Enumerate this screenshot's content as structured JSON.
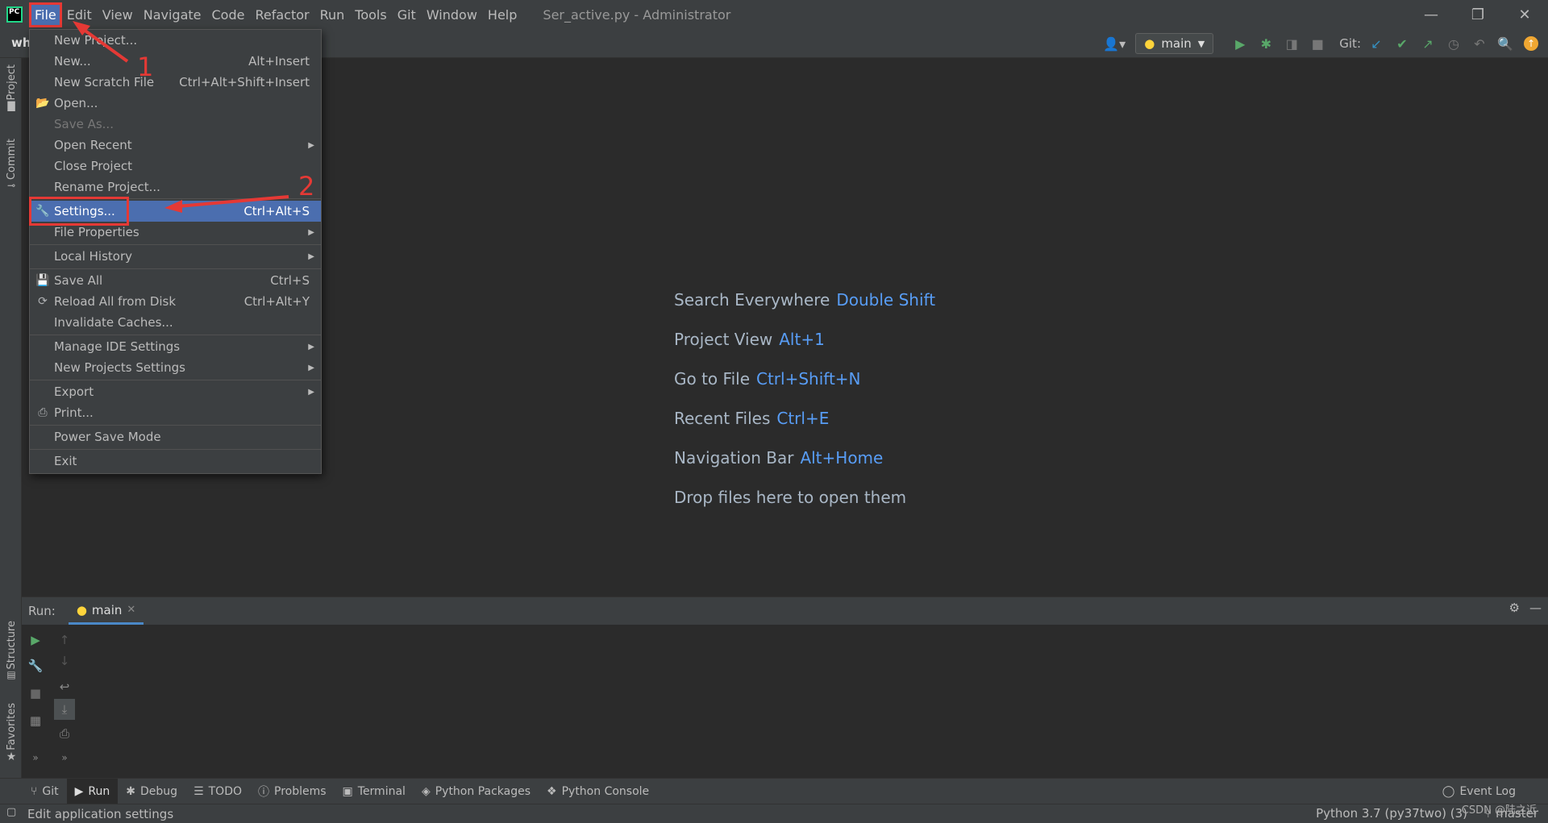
{
  "menubar": {
    "items": [
      "File",
      "Edit",
      "View",
      "Navigate",
      "Code",
      "Refactor",
      "Run",
      "Tools",
      "Git",
      "Window",
      "Help"
    ],
    "window_title": "Ser_active.py - Administrator"
  },
  "toolbar": {
    "project_crumb": "wh",
    "run_config": "main",
    "git_label": "Git:"
  },
  "left_strip": {
    "project": "Project",
    "commit": "Commit",
    "structure": "Structure",
    "favorites": "Favorites"
  },
  "file_menu": {
    "items": [
      {
        "label": "New Project...",
        "key": ""
      },
      {
        "label": "New...",
        "key": "Alt+Insert"
      },
      {
        "label": "New Scratch File",
        "key": "Ctrl+Alt+Shift+Insert"
      },
      {
        "label": "Open...",
        "key": ""
      },
      {
        "label": "Save As...",
        "key": ""
      },
      {
        "label": "Open Recent",
        "key": ""
      },
      {
        "label": "Close Project",
        "key": ""
      },
      {
        "label": "Rename Project...",
        "key": ""
      },
      {
        "label": "Settings...",
        "key": "Ctrl+Alt+S"
      },
      {
        "label": "File Properties",
        "key": ""
      },
      {
        "label": "Local History",
        "key": ""
      },
      {
        "label": "Save All",
        "key": "Ctrl+S"
      },
      {
        "label": "Reload All from Disk",
        "key": "Ctrl+Alt+Y"
      },
      {
        "label": "Invalidate Caches...",
        "key": ""
      },
      {
        "label": "Manage IDE Settings",
        "key": ""
      },
      {
        "label": "New Projects Settings",
        "key": ""
      },
      {
        "label": "Export",
        "key": ""
      },
      {
        "label": "Print...",
        "key": ""
      },
      {
        "label": "Power Save Mode",
        "key": ""
      },
      {
        "label": "Exit",
        "key": ""
      }
    ]
  },
  "annotations": {
    "step1": "1",
    "step2": "2",
    "color": "#e53935"
  },
  "editor_hints": [
    {
      "text": "Search Everywhere",
      "shortcut": "Double Shift"
    },
    {
      "text": "Project View",
      "shortcut": "Alt+1"
    },
    {
      "text": "Go to File",
      "shortcut": "Ctrl+Shift+N"
    },
    {
      "text": "Recent Files",
      "shortcut": "Ctrl+E"
    },
    {
      "text": "Navigation Bar",
      "shortcut": "Alt+Home"
    },
    {
      "text": "Drop files here to open them",
      "shortcut": ""
    }
  ],
  "run_panel": {
    "title": "Run:",
    "tab": "main"
  },
  "bottom_tabs": [
    "Git",
    "Run",
    "Debug",
    "TODO",
    "Problems",
    "Terminal",
    "Python Packages",
    "Python Console"
  ],
  "event_log": "Event Log",
  "status": {
    "text": "Edit application settings",
    "interpreter": "Python 3.7 (py37two) (3)",
    "branch": "master",
    "watermark": "CSDN @陆之近"
  },
  "colors": {
    "accent": "#4b6eaf",
    "shortcut": "#589df6",
    "run_green": "#59a869"
  }
}
